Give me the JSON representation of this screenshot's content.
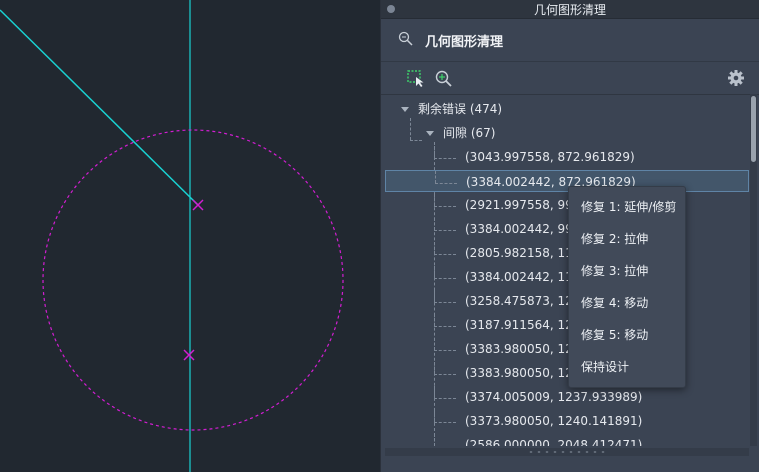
{
  "palette": {
    "window_title": "几何图形清理",
    "header_title": "几何图形清理",
    "toolbar": {
      "select_icon": "select-objects-icon",
      "zoom_icon": "zoom-to-error-icon",
      "settings_icon": "gear-icon"
    },
    "tree": {
      "root_label": "剩余错误 (474)",
      "group_label": "间隙 (67)",
      "items": [
        "(3043.997558, 872.961829)",
        "(3384.002442, 872.961829)",
        "(2921.997558, 992.",
        "(3384.002442, 992",
        "(2805.982158, 1113",
        "(3384.002442, 1114",
        "(3258.475873, 1204",
        "(3187.911564, 1214",
        "(3383.980050, 123",
        "(3383.980050, 123",
        "(3374.005009, 1237.933989)",
        "(3373.980050, 1240.141891)",
        "(2586.000000, 2048.412471)"
      ],
      "selected_index": 1
    }
  },
  "context_menu": {
    "items": [
      "修复 1: 延伸/修剪",
      "修复 2: 拉伸",
      "修复 3: 拉伸",
      "修复 4: 移动",
      "修复 5: 移动",
      "保持设计"
    ]
  },
  "colors": {
    "accent_cyan": "#19d2d2",
    "magenta": "#d21ed2",
    "selection": "#43566a"
  }
}
